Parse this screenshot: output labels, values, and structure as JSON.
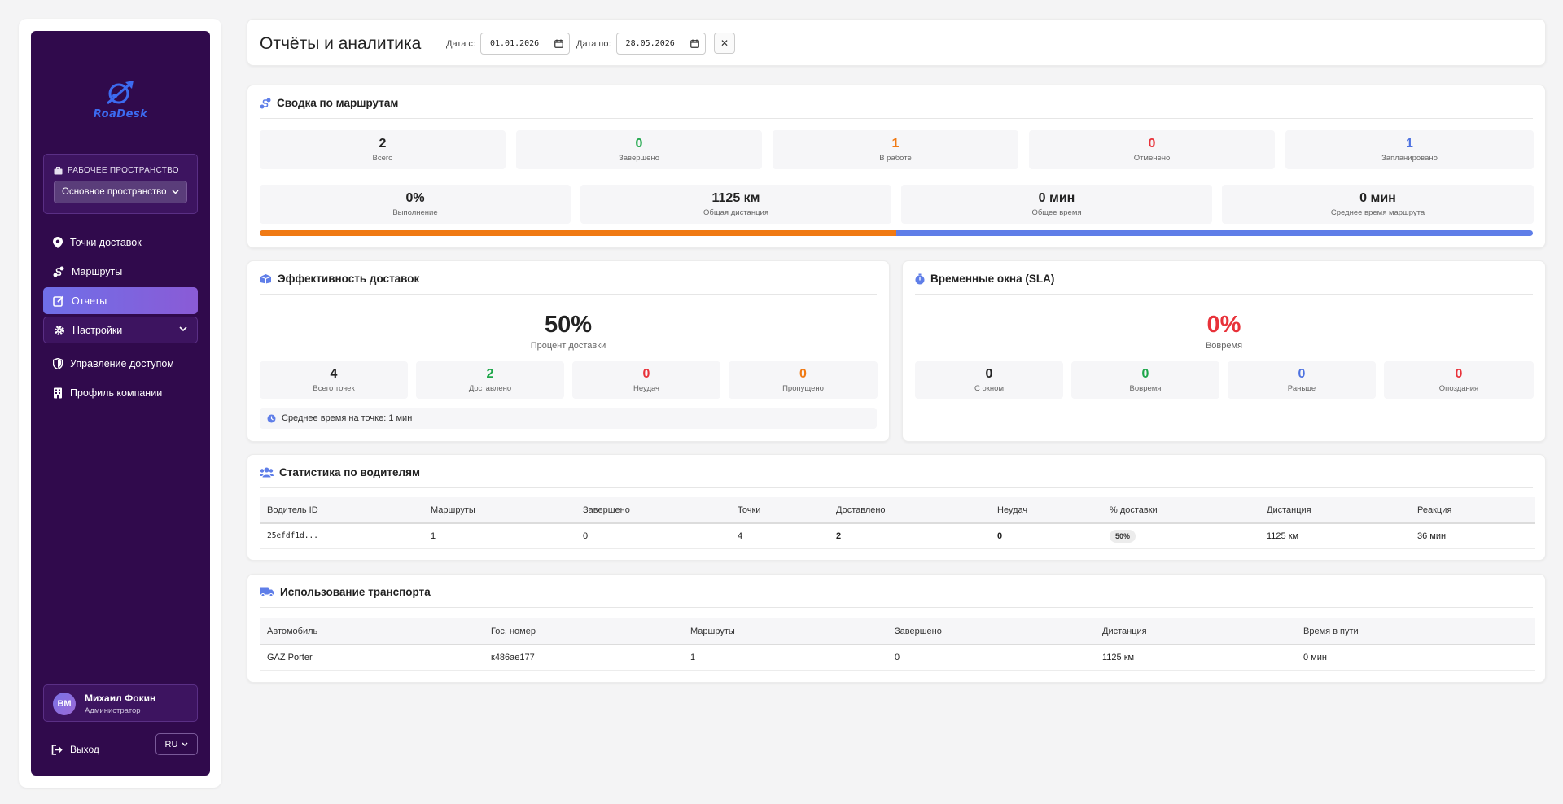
{
  "app": {
    "logo_text": "RoaDesk",
    "workspace_label": "РАБОЧЕЕ ПРОСТРАНСТВО",
    "workspace_value": "Основное пространство"
  },
  "nav": {
    "items": [
      {
        "label": "Точки доставок",
        "icon": "map-pin-icon"
      },
      {
        "label": "Маршруты",
        "icon": "route-icon"
      },
      {
        "label": "Отчеты",
        "icon": "edit-report-icon",
        "active": true
      },
      {
        "label": "Настройки",
        "icon": "gear-icon",
        "expandable": true
      },
      {
        "label": "Управление доступом",
        "icon": "shield-icon"
      },
      {
        "label": "Профиль компании",
        "icon": "building-icon"
      }
    ]
  },
  "user": {
    "initials": "ВМ",
    "name": "Михаил Фокин",
    "role": "Администратор"
  },
  "footer": {
    "logout_label": "Выход",
    "lang": "RU"
  },
  "header": {
    "title": "Отчёты и аналитика",
    "date_from_label": "Дата с:",
    "date_from_value": "01.01.2026",
    "date_to_label": "Дата по:",
    "date_to_value": "28.05.2026",
    "clear_label": "✕"
  },
  "routes_summary": {
    "title": "Сводка по маршрутам",
    "counts": [
      {
        "value": "2",
        "label": "Всего",
        "color": "#222222"
      },
      {
        "value": "0",
        "label": "Завершено",
        "color": "#1ea64a"
      },
      {
        "value": "1",
        "label": "В работе",
        "color": "#f07a14"
      },
      {
        "value": "0",
        "label": "Отменено",
        "color": "#e8323a"
      },
      {
        "value": "1",
        "label": "Запланировано",
        "color": "#4e72e0"
      }
    ],
    "metrics": [
      {
        "value": "0%",
        "label": "Выполнение"
      },
      {
        "value": "1125 км",
        "label": "Общая дистанция"
      },
      {
        "value": "0 мин",
        "label": "Общее время"
      },
      {
        "value": "0 мин",
        "label": "Среднее время маршрута"
      }
    ],
    "progress_in_work_fraction": 0.5
  },
  "efficiency": {
    "title": "Эффективность доставок",
    "percent": "50%",
    "percent_label": "Процент доставки",
    "stats": [
      {
        "value": "4",
        "label": "Всего точек",
        "color": "#222222"
      },
      {
        "value": "2",
        "label": "Доставлено",
        "color": "#1ea64a"
      },
      {
        "value": "0",
        "label": "Неудач",
        "color": "#e8323a"
      },
      {
        "value": "0",
        "label": "Пропущено",
        "color": "#f07a14"
      }
    ],
    "avg_time": "Среднее время на точке: 1 мин"
  },
  "sla": {
    "title": "Временные окна (SLA)",
    "percent": "0%",
    "percent_label": "Вовремя",
    "stats": [
      {
        "value": "0",
        "label": "С окном",
        "color": "#222222"
      },
      {
        "value": "0",
        "label": "Вовремя",
        "color": "#1ea64a"
      },
      {
        "value": "0",
        "label": "Раньше",
        "color": "#4e72e0"
      },
      {
        "value": "0",
        "label": "Опоздания",
        "color": "#e8323a"
      }
    ]
  },
  "drivers": {
    "title": "Статистика по водителям",
    "columns": [
      "Водитель ID",
      "Маршруты",
      "Завершено",
      "Точки",
      "Доставлено",
      "Неудач",
      "% доставки",
      "Дистанция",
      "Реакция"
    ],
    "rows": [
      [
        "25efdf1d...",
        "1",
        "0",
        "4",
        "2",
        "0",
        "50%",
        "1125 км",
        "36 мин"
      ]
    ]
  },
  "transport": {
    "title": "Использование транспорта",
    "columns": [
      "Автомобиль",
      "Гос. номер",
      "Маршруты",
      "Завершено",
      "Дистанция",
      "Время в пути"
    ],
    "rows": [
      [
        "GAZ Porter",
        "к486ае177",
        "1",
        "0",
        "1125 км",
        "0 мин"
      ]
    ]
  }
}
